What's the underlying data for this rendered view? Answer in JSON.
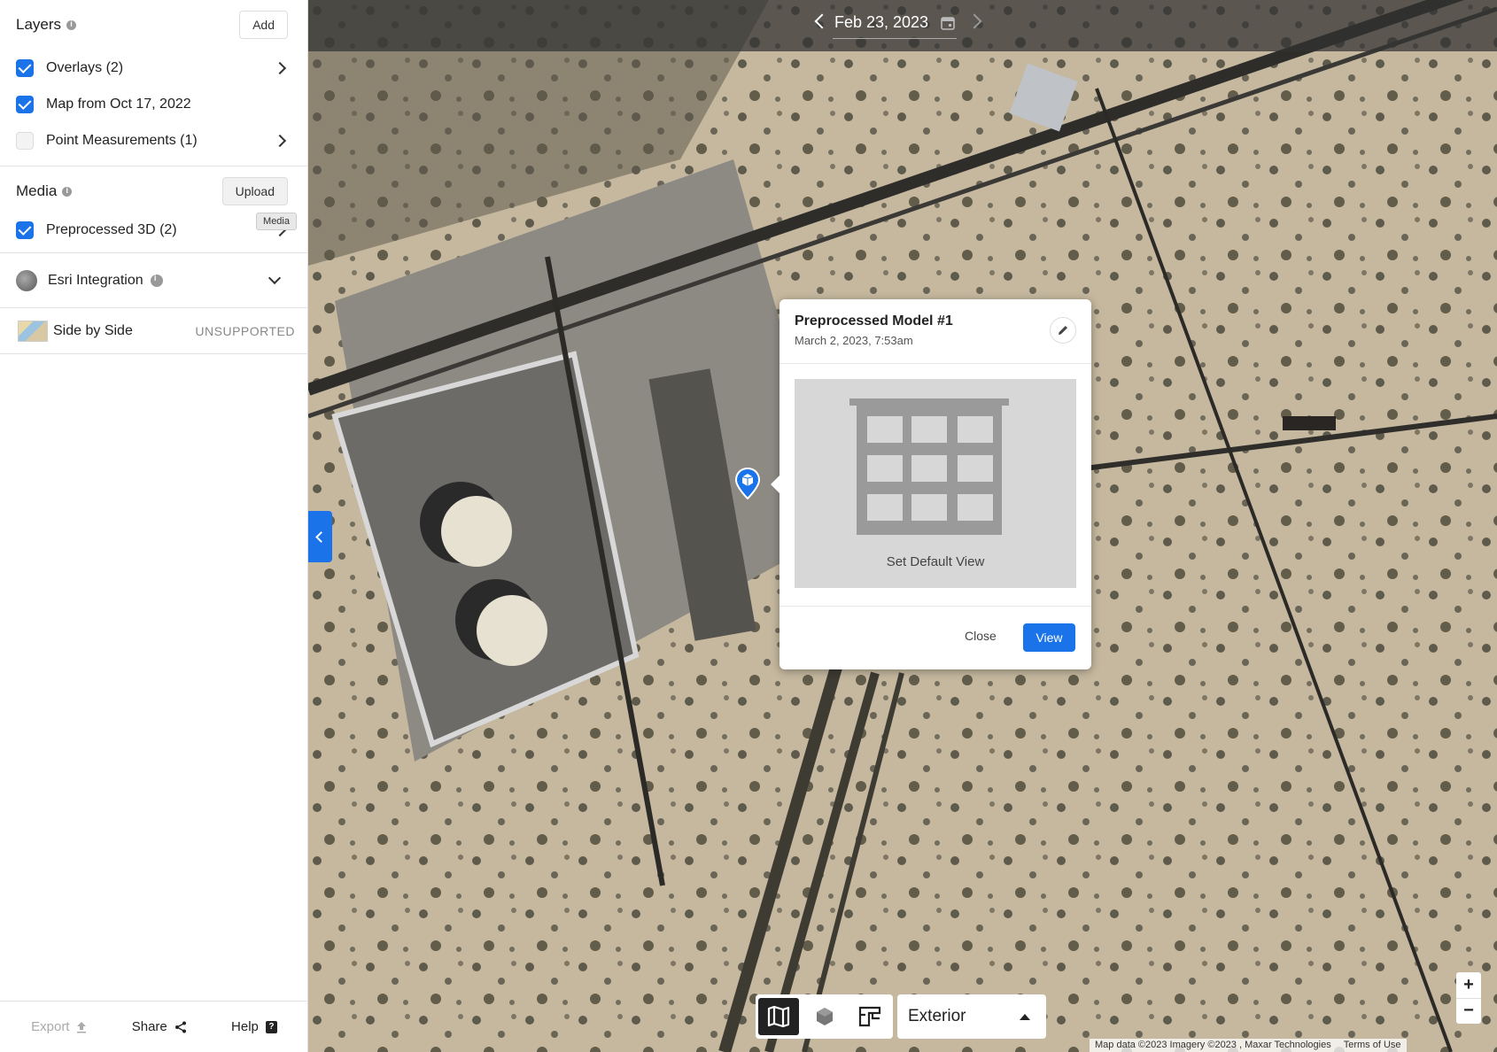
{
  "sidebar": {
    "layers": {
      "title": "Layers",
      "add_label": "Add",
      "items": [
        {
          "label": "Overlays (2)",
          "checked": true,
          "has_arrow": true
        },
        {
          "label": "Map from Oct 17, 2022",
          "checked": true,
          "has_arrow": false
        },
        {
          "label": "Point Measurements (1)",
          "checked": false,
          "has_arrow": true
        }
      ]
    },
    "media": {
      "title": "Media",
      "upload_label": "Upload",
      "tooltip": "Media",
      "items": [
        {
          "label": "Preprocessed 3D (2)",
          "checked": true,
          "has_arrow": true
        }
      ]
    },
    "esri": {
      "label": "Esri Integration",
      "icon": "globe-icon"
    },
    "side_by_side": {
      "label": "Side by Side",
      "status": "UNSUPPORTED",
      "icon": "map-thumbnail-icon"
    },
    "footer": {
      "export_label": "Export",
      "share_label": "Share",
      "help_label": "Help"
    }
  },
  "topbar": {
    "date": "Feb 23, 2023",
    "icons": [
      "chevron-left-icon",
      "calendar-icon",
      "chevron-right-icon"
    ]
  },
  "popup": {
    "title": "Preprocessed Model #1",
    "date": "March 2, 2023, 7:53am",
    "thumbnail_label": "Set Default View",
    "close_label": "Close",
    "view_label": "View"
  },
  "view_modes": {
    "items": [
      "map-icon",
      "cube-icon",
      "floorplan-icon"
    ],
    "active": "map-icon"
  },
  "exterior_select": {
    "value": "Exterior"
  },
  "zoom": {
    "in_label": "+",
    "out_label": "−"
  },
  "attribution": {
    "text": "Map data ©2023 Imagery ©2023 , Maxar Technologies",
    "terms": "Terms of Use"
  },
  "colors": {
    "accent": "#1a73e8",
    "topbar": "#323232",
    "ground": "#c4b69c"
  }
}
